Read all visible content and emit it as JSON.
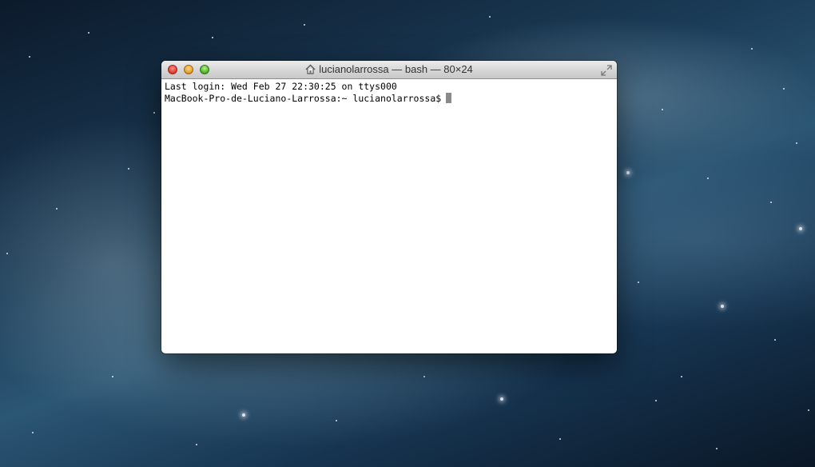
{
  "window": {
    "title": "lucianolarrossa — bash — 80×24",
    "title_icon": "home-icon",
    "buttons": {
      "close": "close-button",
      "minimize": "minimize-button",
      "zoom": "zoom-button"
    },
    "fullscreen_icon": "fullscreen-icon"
  },
  "terminal": {
    "lines": [
      "Last login: Wed Feb 27 22:30:25 on ttys000",
      "MacBook-Pro-de-Luciano-Larrossa:~ lucianolarrossa$"
    ],
    "cursor_color": "#8a8a8a"
  },
  "colors": {
    "close": "#e0443a",
    "minimize": "#e6a330",
    "zoom": "#58b830"
  }
}
